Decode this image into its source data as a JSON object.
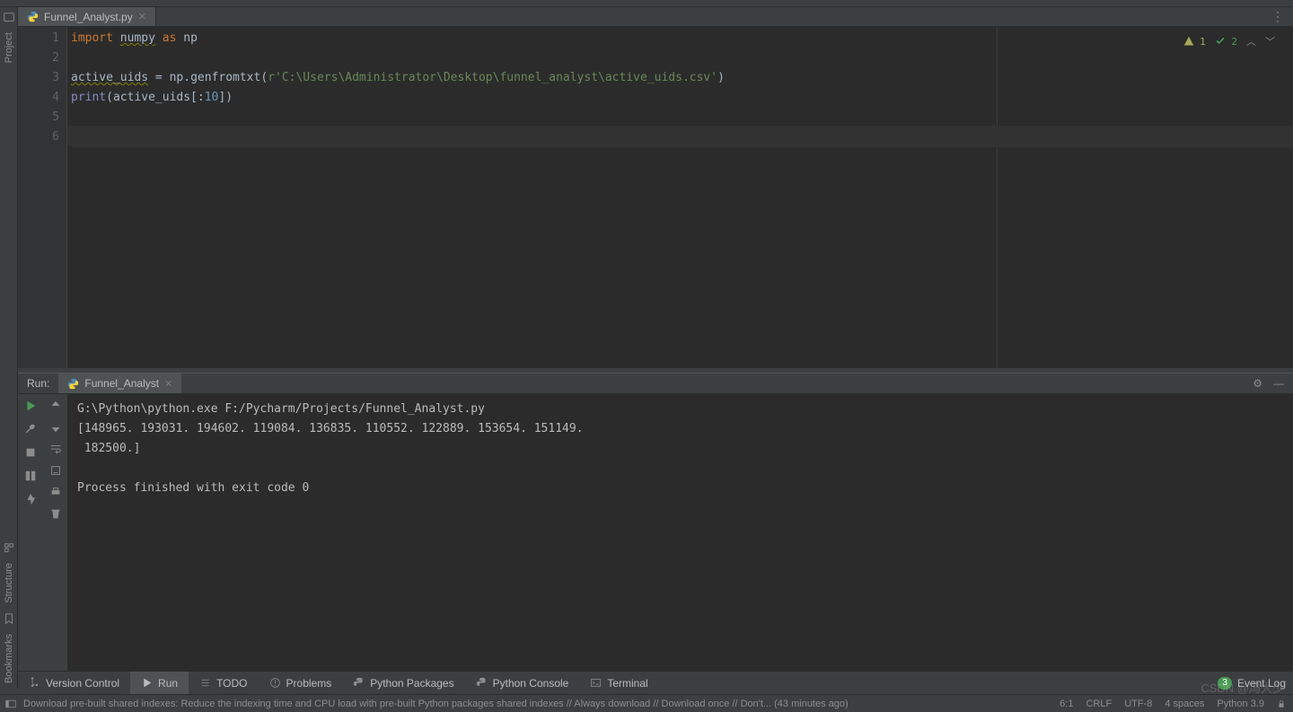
{
  "tabs": {
    "file": "Funnel_Analyst.py"
  },
  "editor": {
    "lines": [
      "1",
      "2",
      "3",
      "4",
      "5",
      "6"
    ],
    "code": {
      "l1_import": "import",
      "l1_numpy": "numpy",
      "l1_as": "as",
      "l1_np": "np",
      "l3_var": "active_uids",
      "l3_eq": " = np.",
      "l3_fn": "genfromtxt",
      "l3_open": "(",
      "l3_r": "r",
      "l3_str": "'C:\\Users\\Administrator\\Desktop\\funnel_analyst\\active_uids.csv'",
      "l3_close": ")",
      "l4_print": "print",
      "l4_open": "(active_uids[:",
      "l4_num": "10",
      "l4_close": "])"
    },
    "warnings": "1",
    "checks": "2"
  },
  "run": {
    "label": "Run:",
    "tab": "Funnel_Analyst",
    "console_l1": "G:\\Python\\python.exe F:/Pycharm/Projects/Funnel_Analyst.py",
    "console_l2": "[148965. 193031. 194602. 119084. 136835. 110552. 122889. 153654. 151149.",
    "console_l3": " 182500.]",
    "console_l4": "",
    "console_l5": "Process finished with exit code 0"
  },
  "bottom": {
    "version_control": "Version Control",
    "run": "Run",
    "todo": "TODO",
    "problems": "Problems",
    "packages": "Python Packages",
    "console": "Python Console",
    "terminal": "Terminal",
    "event_badge": "3",
    "event_log": "Event Log"
  },
  "status": {
    "msg": "Download pre-built shared indexes: Reduce the indexing time and CPU load with pre-built Python packages shared indexes // Always download // Download once // Don't... (43 minutes ago)",
    "pos": "6:1",
    "crlf": "CRLF",
    "enc": "UTF-8",
    "indent": "4 spaces",
    "python": "Python 3.9"
  },
  "side": {
    "project": "Project",
    "structure": "Structure",
    "bookmarks": "Bookmarks"
  },
  "watermark": "CSDN @冯大少"
}
